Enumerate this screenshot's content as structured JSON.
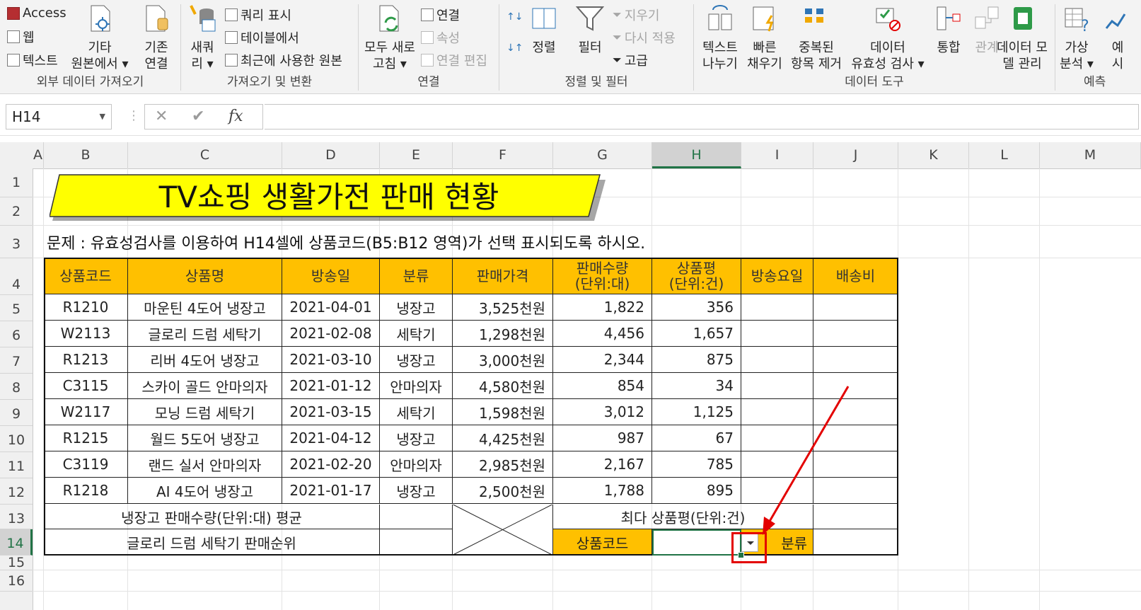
{
  "ribbon": {
    "groups": [
      {
        "label": "외부 데이터 가져오기"
      },
      {
        "label": "가져오기 및 변환"
      },
      {
        "label": "연결"
      },
      {
        "label": "정렬 및 필터"
      },
      {
        "label": "데이터 도구"
      },
      {
        "label": "예측"
      }
    ],
    "external": {
      "access": "Access",
      "web": "웹",
      "text": "텍스트",
      "other_line1": "기타",
      "other_line2": "원본에서 ▾",
      "existing_line1": "기존",
      "existing_line2": "연결"
    },
    "transform": {
      "new_query_line1": "새쿼",
      "new_query_line2": "리 ▾",
      "show_query": "쿼리 표시",
      "from_table": "테이블에서",
      "recent_sources": "최근에 사용한 원본"
    },
    "connections": {
      "refresh_line1": "모두 새로",
      "refresh_line2": "고침 ▾",
      "connections": "연결",
      "properties": "속성",
      "edit_links": "연결 편집"
    },
    "sort_filter": {
      "sort": "정렬",
      "filter": "필터",
      "clear": "지우기",
      "reapply": "다시 적용",
      "advanced": "고급"
    },
    "data_tools": {
      "text_to_cols_line1": "텍스트",
      "text_to_cols_line2": "나누기",
      "flash_fill_line1": "빠른",
      "flash_fill_line2": "채우기",
      "remove_dup_line1": "중복된",
      "remove_dup_line2": "항목 제거",
      "validation_line1": "데이터",
      "validation_line2": "유효성 검사 ▾",
      "consolidate": "통합",
      "relationships": "관계",
      "data_model_line1": "데이터 모",
      "data_model_line2": "델 관리"
    },
    "forecast": {
      "whatif_line1": "가상",
      "whatif_line2": "분석 ▾",
      "sheet_line1": "예",
      "sheet_line2": "시"
    }
  },
  "formula_bar": {
    "name_box": "H14",
    "fx": "fx",
    "cancel": "✕",
    "enter": "✔",
    "formula": ""
  },
  "columns": [
    "A",
    "B",
    "C",
    "D",
    "E",
    "F",
    "G",
    "H",
    "I",
    "J",
    "K",
    "L",
    "M"
  ],
  "rows": [
    "1",
    "2",
    "3",
    "4",
    "5",
    "6",
    "7",
    "8",
    "9",
    "10",
    "11",
    "12",
    "13",
    "14",
    "15",
    "16"
  ],
  "sheet": {
    "title": "TV쇼핑 생활가전 판매 현황",
    "problem": "문제 : 유효성검사를 이용하여 H14셀에 상품코드(B5:B12 영역)가 선택 표시되도록 하시오.",
    "headers": [
      "상품코드",
      "상품명",
      "방송일",
      "분류",
      "판매가격",
      "판매수량\n(단위:대)",
      "상품평\n(단위:건)",
      "방송요일",
      "배송비"
    ],
    "header_sub": {
      "qty_1": "판매수량",
      "qty_2": "(단위:대)",
      "rev_1": "상품평",
      "rev_2": "(단위:건)"
    },
    "data": [
      [
        "R1210",
        "마운틴 4도어 냉장고",
        "2021-04-01",
        "냉장고",
        "3,525천원",
        "1,822",
        "356"
      ],
      [
        "W2113",
        "글로리 드럼 세탁기",
        "2021-02-08",
        "세탁기",
        "1,298천원",
        "4,456",
        "1,657"
      ],
      [
        "R1213",
        "리버 4도어 냉장고",
        "2021-03-10",
        "냉장고",
        "3,000천원",
        "2,344",
        "875"
      ],
      [
        "C3115",
        "스카이 골드 안마의자",
        "2021-01-12",
        "안마의자",
        "4,580천원",
        "854",
        "34"
      ],
      [
        "W2117",
        "모닝 드럼 세탁기",
        "2021-03-15",
        "세탁기",
        "1,598천원",
        "3,012",
        "1,125"
      ],
      [
        "R1215",
        "월드 5도어 냉장고",
        "2021-04-12",
        "냉장고",
        "4,425천원",
        "987",
        "67"
      ],
      [
        "C3119",
        "랜드 실서 안마의자",
        "2021-02-20",
        "안마의자",
        "2,985천원",
        "2,167",
        "785"
      ],
      [
        "R1218",
        "AI 4도어 냉장고",
        "2021-01-17",
        "냉장고",
        "2,500천원",
        "1,788",
        "895"
      ]
    ],
    "summary": {
      "fridge_avg": "냉장고 판매수량(단위:대) 평균",
      "glory_rank": "글로리 드럼 세탁기 판매순위",
      "max_review": "최다 상품평(단위:건)",
      "code_label": "상품코드",
      "category_label": "분류"
    }
  },
  "colors": {
    "header_fill": "#ffc000",
    "banner_fill": "#ffff00",
    "accent": "#217346",
    "annotation": "#e30000"
  }
}
